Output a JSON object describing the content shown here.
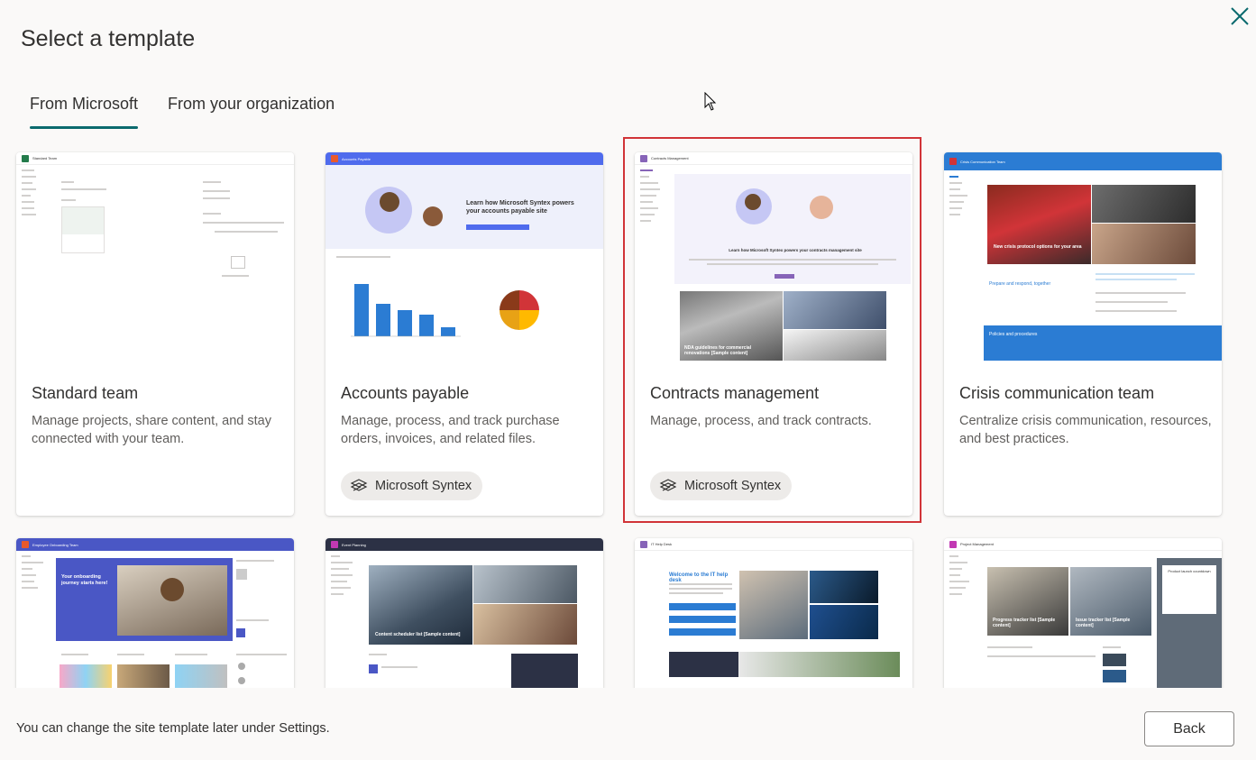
{
  "dialog": {
    "title": "Select a template",
    "close_icon": "close-icon"
  },
  "tabs": [
    {
      "label": "From Microsoft",
      "active": true
    },
    {
      "label": "From your organization",
      "active": false
    }
  ],
  "templates": [
    {
      "title": "Standard team",
      "description": "Manage projects, share content, and stay connected with your team.",
      "badge": "",
      "thumb_title": "Standard Team",
      "accent": "#237b4b"
    },
    {
      "title": "Accounts payable",
      "description": "Manage, process, and track purchase orders, invoices, and related files.",
      "badge": "Microsoft Syntex",
      "thumb_title": "Accounts Payable",
      "accent": "#4f6bed"
    },
    {
      "title": "Contracts management",
      "description": "Manage, process, and track contracts.",
      "badge": "Microsoft Syntex",
      "thumb_title": "Contracts Management",
      "accent": "#8764b8",
      "selected": true
    },
    {
      "title": "Crisis communication team",
      "description": "Centralize crisis communication, resources, and best practices.",
      "badge": "",
      "thumb_title": "Crisis Communication Team",
      "accent": "#2b7cd3"
    },
    {
      "title": "",
      "description": "",
      "badge": "",
      "thumb_title": "Employee Onboarding Team",
      "accent": "#4a57c5"
    },
    {
      "title": "",
      "description": "",
      "badge": "",
      "thumb_title": "Event Planning",
      "accent": "#2c3145"
    },
    {
      "title": "",
      "description": "",
      "badge": "",
      "thumb_title": "IT Help Desk",
      "accent": "#8764b8"
    },
    {
      "title": "",
      "description": "",
      "badge": "",
      "thumb_title": "Project Management",
      "accent": "#c239b3"
    }
  ],
  "thumbs": {
    "accounts_headline": "Learn how Microsoft Syntex powers your accounts payable site",
    "contracts_headline": "Learn how Microsoft Syntex powers your contracts management site",
    "contracts_tile_1": "NDA guidelines for commercial renovations [Sample content]",
    "crisis_tile_1": "New crisis protocol options for your area",
    "crisis_prepare": "Prepare and respond, together",
    "crisis_policies": "Policies and procedures",
    "onboarding_headline": "Your onboarding journey starts here!",
    "event_tile_1": "Content scheduler list [Sample content]",
    "it_headline": "Welcome to the IT help desk",
    "pm_countdown": "Product launch countdown",
    "pm_tile_1": "Progress tracker list [Sample content]",
    "pm_tile_2": "Issue tracker list [Sample content]"
  },
  "footer": {
    "note": "You can change the site template later under Settings.",
    "back_label": "Back"
  }
}
